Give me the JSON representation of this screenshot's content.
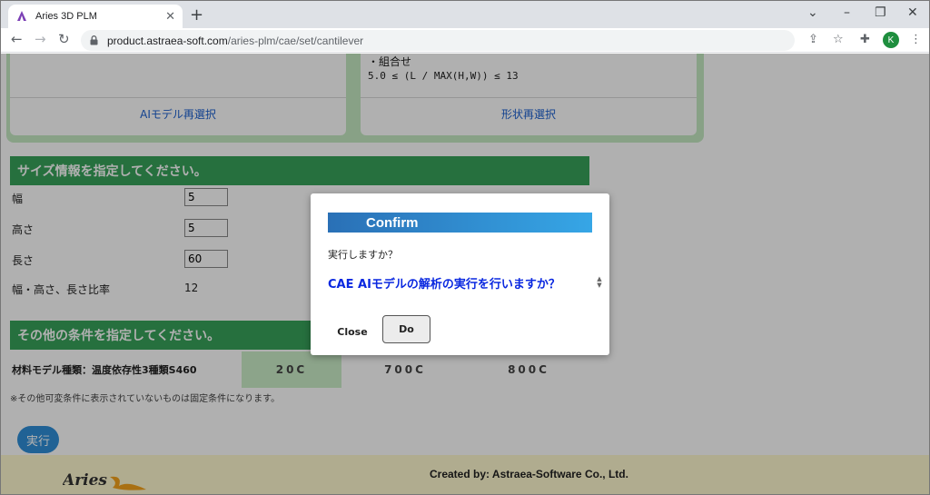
{
  "browser": {
    "tab_title": "Aries 3D PLM",
    "url_host": "product.astraea-soft.com",
    "url_path": "/aries-plm/cae/set/cantilever",
    "profile_initial": "K",
    "icons": [
      "aries-favicon",
      "close-icon",
      "plus-icon",
      "chevron-down-icon",
      "minimize-icon",
      "restore-icon",
      "close-window-icon",
      "back-arrow-icon",
      "forward-arrow-icon",
      "reload-icon",
      "lock-icon",
      "share-icon",
      "star-icon",
      "puzzle-icon",
      "kebab-menu-icon"
    ]
  },
  "top_cards": {
    "condition_label": "・組合せ",
    "condition_formula": "5.0 ≤ (L / MAX(H,W)) ≤ 13",
    "reselect_model": "AIモデル再選択",
    "reselect_shape": "形状再選択"
  },
  "size_section": {
    "title": "サイズ情報を指定してください。",
    "width_label": "幅",
    "width_value": "5",
    "height_label": "高さ",
    "height_value": "5",
    "length_label": "長さ",
    "length_value": "60",
    "ratio_label": "幅・高さ、長さ比率",
    "ratio_value": "12"
  },
  "other_section": {
    "title": "その他の条件を指定してください。",
    "material_label": "材料モデル種類：温度依存性3種類S460",
    "temperatures": [
      "20C",
      "700C",
      "800C"
    ],
    "selected_temperature": "20C",
    "note": "※その他可変条件に表示されていないものは固定条件になります。",
    "execute_label": "実行"
  },
  "footer": {
    "logo_text": "Aries",
    "credit": "Created by: Astraea-Software Co., Ltd."
  },
  "modal": {
    "title": "Confirm",
    "subtitle": "実行しますか？",
    "question": "CAE AIモデルの解析の実行を行いますか？",
    "close_label": "Close",
    "do_label": "Do"
  },
  "colors": {
    "section_green": "#37a35a",
    "card_green": "#c5e9c2",
    "link_blue": "#1a5fd0",
    "question_blue": "#0a28e0",
    "execute_blue": "#2f8fd8",
    "footer_yellow": "#fff9cf"
  }
}
